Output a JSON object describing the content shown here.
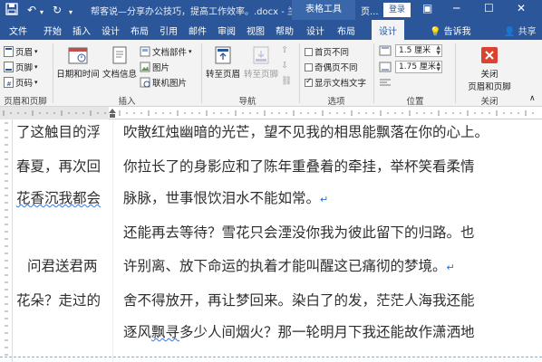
{
  "titlebar": {
    "doc_title": "帮客说—分享办公技巧，提高工作效率。.docx - 兰...",
    "context_group": "表格工具",
    "yepei": "页...",
    "login": "登录"
  },
  "tabs": [
    {
      "label": "文件"
    },
    {
      "label": "开始"
    },
    {
      "label": "插入"
    },
    {
      "label": "设计"
    },
    {
      "label": "布局"
    },
    {
      "label": "引用"
    },
    {
      "label": "邮件"
    },
    {
      "label": "审阅"
    },
    {
      "label": "视图"
    },
    {
      "label": "帮助"
    },
    {
      "label": "设计"
    },
    {
      "label": "布局"
    },
    {
      "label": "设计"
    }
  ],
  "tell_me": "告诉我",
  "share": "共享",
  "ribbon": {
    "header": "页眉",
    "footer": "页脚",
    "page_number": "页码",
    "group_header_footer": "页眉和页脚",
    "date_time": "日期和时间",
    "doc_info": "文档信息",
    "doc_parts": "文档部件",
    "picture": "图片",
    "online_picture": "联机图片",
    "group_insert": "插入",
    "goto_header": "转至页眉",
    "goto_footer": "转至页脚",
    "group_nav": "导航",
    "first_page_diff": "首页不同",
    "odd_even_diff": "奇偶页不同",
    "show_doc_text": "显示文档文字",
    "group_options": "选项",
    "header_pos": "1.5 厘米",
    "footer_pos": "1.75 厘米",
    "group_position": "位置",
    "close_label_1": "关闭",
    "close_label_2": "页眉和页脚",
    "group_close": "关闭"
  },
  "doc": {
    "left_lines": [
      "了这触目的浮",
      "春夏，再次回",
      "花香沉我都会",
      "",
      "问君送君两",
      "花朵？走过的",
      ""
    ],
    "right_lines": [
      "吹散红烛幽暗的光芒，望不见我的相思能飘落在你的心上。",
      "你拉长了的身影应和了陈年重叠着的牵挂，举杯笑看柔情",
      "脉脉，世事恨饮泪水不能如常。",
      "还能再去等待？雪花只会湮没你我为彼此留下的归路。也",
      "许别离、放下命运的执着才能叫醒这已痛彻的梦境。",
      "舍不得放开，再让梦回来。染白了的发，茫茫人海我还能",
      "逐风飘寻多少人间烟火？那一轮明月下我还能故作潇洒地"
    ],
    "para_mark": "↵",
    "squiggle_text": "飘寻"
  },
  "colors": {
    "title_bg": "#2b579a",
    "close_red": "#d9432f"
  }
}
